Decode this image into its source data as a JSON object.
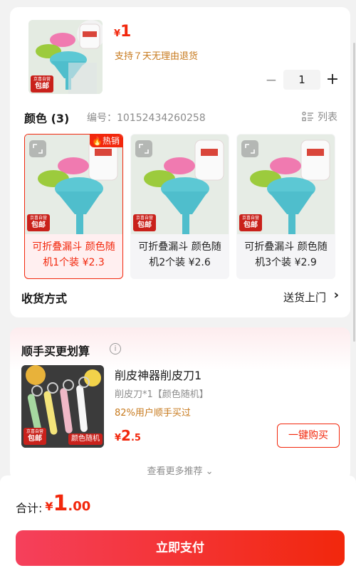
{
  "product": {
    "yen": "¥",
    "price": "1",
    "return_note": "支持７天无理由退货",
    "quantity": "1",
    "minus": "−",
    "plus": "+"
  },
  "color_section": {
    "title": "颜色 (3)",
    "sku": "编号：10152434260258",
    "list_label": "列表"
  },
  "variants": [
    {
      "name": "可折叠漏斗 颜色随机1个装",
      "price": "¥2.3",
      "hot": "热销",
      "badge_top": "京喜自营",
      "badge_bottom": "包邮"
    },
    {
      "name": "可折叠漏斗 颜色随机2个装",
      "price": "¥2.6",
      "badge_top": "京喜自营",
      "badge_bottom": "包邮"
    },
    {
      "name": "可折叠漏斗 颜色随机3个装",
      "price": "¥2.9",
      "badge_top": "京喜自营",
      "badge_bottom": "包邮"
    }
  ],
  "main_badge": {
    "top": "京喜自营",
    "bottom": "包邮"
  },
  "shipping": {
    "label": "收货方式",
    "value": "送货上门",
    "chevron": "›"
  },
  "recommend": {
    "title": "顺手买更划算",
    "info": "i",
    "name": "削皮神器削皮刀1",
    "spec": "削皮刀*1【颜色随机】",
    "stat": "82%用户顺手买过",
    "yen": "¥",
    "price_int": "2",
    "price_dec": ".5",
    "buy_label": "一键购买",
    "more": "查看更多推荐 ⌄",
    "badge_top": "京喜自营",
    "badge_bottom": "包邮",
    "color_tag": "颜色随机"
  },
  "footer": {
    "total_label": "合计:",
    "yen": "¥",
    "total_int": "1",
    "total_dec": ".00",
    "pay_label": "立即支付"
  }
}
